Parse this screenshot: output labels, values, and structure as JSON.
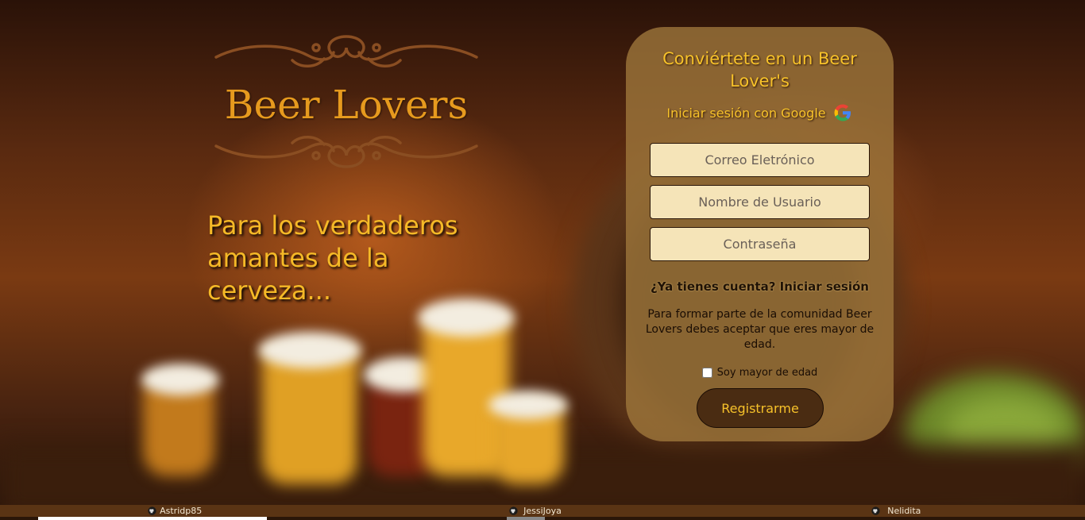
{
  "brand": {
    "title": "Beer Lovers",
    "tagline": "Para los verdaderos amantes de la cerveza..."
  },
  "form": {
    "title": "Conviértete en un Beer Lover's",
    "google_label": "Iniciar sesión con Google",
    "email_placeholder": "Correo Eletrónico",
    "username_placeholder": "Nombre de Usuario",
    "password_placeholder": "Contraseña",
    "login_question": "¿Ya tienes cuenta?",
    "login_link": "Iniciar sesión",
    "age_notice": "Para formar parte de la comunidad Beer Lovers debes aceptar que eres mayor de edad.",
    "age_checkbox_label": "Soy mayor de edad",
    "age_checked": false,
    "register_button": "Registrarme"
  },
  "footer": {
    "credits": [
      {
        "name": "Astridp85",
        "icon": "github-icon"
      },
      {
        "name": "JessiJoya",
        "icon": "github-icon"
      },
      {
        "name": "Nelidita",
        "icon": "github-icon"
      }
    ]
  },
  "colors": {
    "accent": "#f7c22a",
    "logo": "#e69a1e",
    "button": "#4a2c12",
    "field": "#f5e4b8"
  }
}
